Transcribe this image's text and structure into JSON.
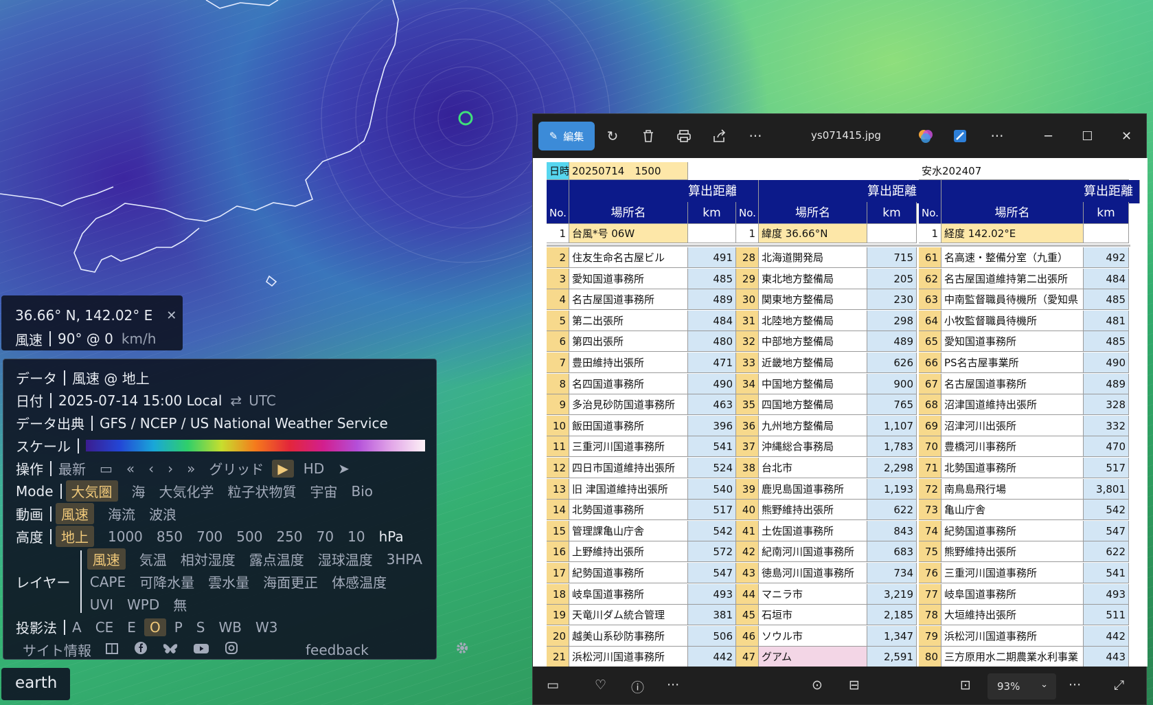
{
  "coord_panel": {
    "position": "36.66° N, 142.02° E",
    "close": "✕",
    "wind_label": "風速",
    "wind_value": "90° @ 0",
    "wind_unit": "km/h"
  },
  "controls": {
    "data_label": "データ",
    "data_value": "風速 @ 地上",
    "date_label": "日付",
    "date_value": "2025-07-14 15:00 Local",
    "date_swap": "⇄",
    "date_utc": "UTC",
    "source_label": "データ出典",
    "source_value": "GFS / NCEP / US National Weather Service",
    "scale_label": "スケール",
    "ops_label": "操作",
    "ops": {
      "latest": "最新",
      "calendar": "▭",
      "back_fast": "«",
      "back": "‹",
      "forward": "›",
      "forward_fast": "»",
      "grid": "グリッド",
      "play": "▶",
      "hd": "HD",
      "locate": "➤"
    },
    "mode_label": "Mode",
    "modes": [
      "大気圏",
      "海",
      "大気化学",
      "粒子状物質",
      "宇宙",
      "Bio"
    ],
    "anim_label": "動画",
    "anims": [
      "風速",
      "海流",
      "波浪"
    ],
    "height_label": "高度",
    "heights": [
      "地上",
      "1000",
      "850",
      "700",
      "500",
      "250",
      "70",
      "10"
    ],
    "height_unit": "hPa",
    "layer_label": "レイヤー",
    "layers_row1": [
      "風速",
      "気温",
      "相対湿度",
      "露点温度",
      "湿球温度",
      "3HPA"
    ],
    "layers_row2": [
      "CAPE",
      "可降水量",
      "雲水量",
      "海面更正",
      "体感温度"
    ],
    "layers_row3": [
      "UVI",
      "WPD",
      "無"
    ],
    "proj_label": "投影法",
    "projections": [
      "A",
      "CE",
      "E",
      "O",
      "P",
      "S",
      "WB",
      "W3"
    ],
    "site_info": "サイト情報",
    "feedback": "feedback",
    "icons": [
      "book-icon",
      "facebook-icon",
      "bluesky-icon",
      "youtube-icon",
      "instagram-icon",
      "gear-icon"
    ]
  },
  "earth_button": "earth",
  "viewer": {
    "edit_label": "編集",
    "filename": "ys071415.jpg",
    "more": "···",
    "zoom": "93%",
    "window_min": "─",
    "window_max": "☐",
    "window_close": "✕"
  },
  "sheet": {
    "datetime_label": "日時",
    "datetime_value": "20250714　1500",
    "ref_label": "安水202407",
    "hdr_no": "No.",
    "hdr_place": "場所名",
    "hdr_dist": "算出距離",
    "hdr_km": "km",
    "info": [
      {
        "no": "1",
        "name": "台風*号 06W"
      },
      {
        "no": "1",
        "name": "緯度 36.66°N"
      },
      {
        "no": "1",
        "name": "経度 142.02°E"
      }
    ],
    "col1": [
      [
        "2",
        "住友生命名古屋ビル",
        "491"
      ],
      [
        "3",
        "愛知国道事務所",
        "485"
      ],
      [
        "4",
        "名古屋国道事務所",
        "489"
      ],
      [
        "5",
        "第二出張所",
        "484"
      ],
      [
        "6",
        "第四出張所",
        "480"
      ],
      [
        "7",
        "豊田維持出張所",
        "471"
      ],
      [
        "8",
        "名四国道事務所",
        "490"
      ],
      [
        "9",
        "多治見砂防国道事務所",
        "463"
      ],
      [
        "10",
        "飯田国道事務所",
        "396"
      ],
      [
        "11",
        "三重河川国道事務所",
        "541"
      ],
      [
        "12",
        "四日市国道維持出張所",
        "524"
      ],
      [
        "13",
        "旧 津国道維持出張所",
        "540"
      ],
      [
        "14",
        "北勢国道事務所",
        "517"
      ],
      [
        "15",
        "管理課亀山庁舎",
        "542"
      ],
      [
        "16",
        "上野維持出張所",
        "572"
      ],
      [
        "17",
        "紀勢国道事務所",
        "547"
      ],
      [
        "18",
        "岐阜国道事務所",
        "493"
      ],
      [
        "19",
        "天竜川ダム統合管理",
        "381"
      ],
      [
        "20",
        "越美山系砂防事務所",
        "506"
      ],
      [
        "21",
        "浜松河川国道事務所",
        "442"
      ]
    ],
    "col2": [
      [
        "28",
        "北海道開発局",
        "715"
      ],
      [
        "29",
        "東北地方整備局",
        "205"
      ],
      [
        "30",
        "関東地方整備局",
        "230"
      ],
      [
        "31",
        "北陸地方整備局",
        "298"
      ],
      [
        "32",
        "中部地方整備局",
        "489"
      ],
      [
        "33",
        "近畿地方整備局",
        "626"
      ],
      [
        "34",
        "中国地方整備局",
        "900"
      ],
      [
        "35",
        "四国地方整備局",
        "765"
      ],
      [
        "36",
        "九州地方整備局",
        "1,107"
      ],
      [
        "37",
        "沖縄総合事務局",
        "1,783"
      ],
      [
        "38",
        "台北市",
        "2,298"
      ],
      [
        "39",
        "鹿児島国道事務所",
        "1,193"
      ],
      [
        "40",
        "熊野維持出張所",
        "622"
      ],
      [
        "41",
        "土佐国道事務所",
        "843"
      ],
      [
        "42",
        "紀南河川国道事務所",
        "683"
      ],
      [
        "43",
        "徳島河川国道事務所",
        "734"
      ],
      [
        "44",
        "マニラ市",
        "3,219"
      ],
      [
        "45",
        "石垣市",
        "2,185"
      ],
      [
        "46",
        "ソウル市",
        "1,347"
      ],
      [
        "47",
        "グアム",
        "2,591"
      ]
    ],
    "col3": [
      [
        "61",
        "名高速・整備分室（九重）",
        "492"
      ],
      [
        "62",
        "名古屋国道維持第二出張所",
        "484"
      ],
      [
        "63",
        "中南監督職員待機所（愛知県",
        "485"
      ],
      [
        "64",
        "小牧監督職員待機所",
        "481"
      ],
      [
        "65",
        "愛知国道事務所",
        "485"
      ],
      [
        "66",
        "PS名古屋事業所",
        "490"
      ],
      [
        "67",
        "名古屋国道事務所",
        "489"
      ],
      [
        "68",
        "沼津国道維持出張所",
        "328"
      ],
      [
        "69",
        "沼津河川出張所",
        "332"
      ],
      [
        "70",
        "豊橋河川事務所",
        "470"
      ],
      [
        "71",
        "北勢国道事務所",
        "517"
      ],
      [
        "72",
        "南鳥島飛行場",
        "3,801"
      ],
      [
        "73",
        "亀山庁舎",
        "542"
      ],
      [
        "74",
        "紀勢国道事務所",
        "547"
      ],
      [
        "75",
        "熊野維持出張所",
        "622"
      ],
      [
        "76",
        "三重河川国道事務所",
        "541"
      ],
      [
        "77",
        "岐阜国道事務所",
        "493"
      ],
      [
        "78",
        "大垣維持出張所",
        "511"
      ],
      [
        "79",
        "浜松河川国道事務所",
        "442"
      ],
      [
        "80",
        "三方原用水二期農業水利事業",
        "443"
      ]
    ]
  }
}
